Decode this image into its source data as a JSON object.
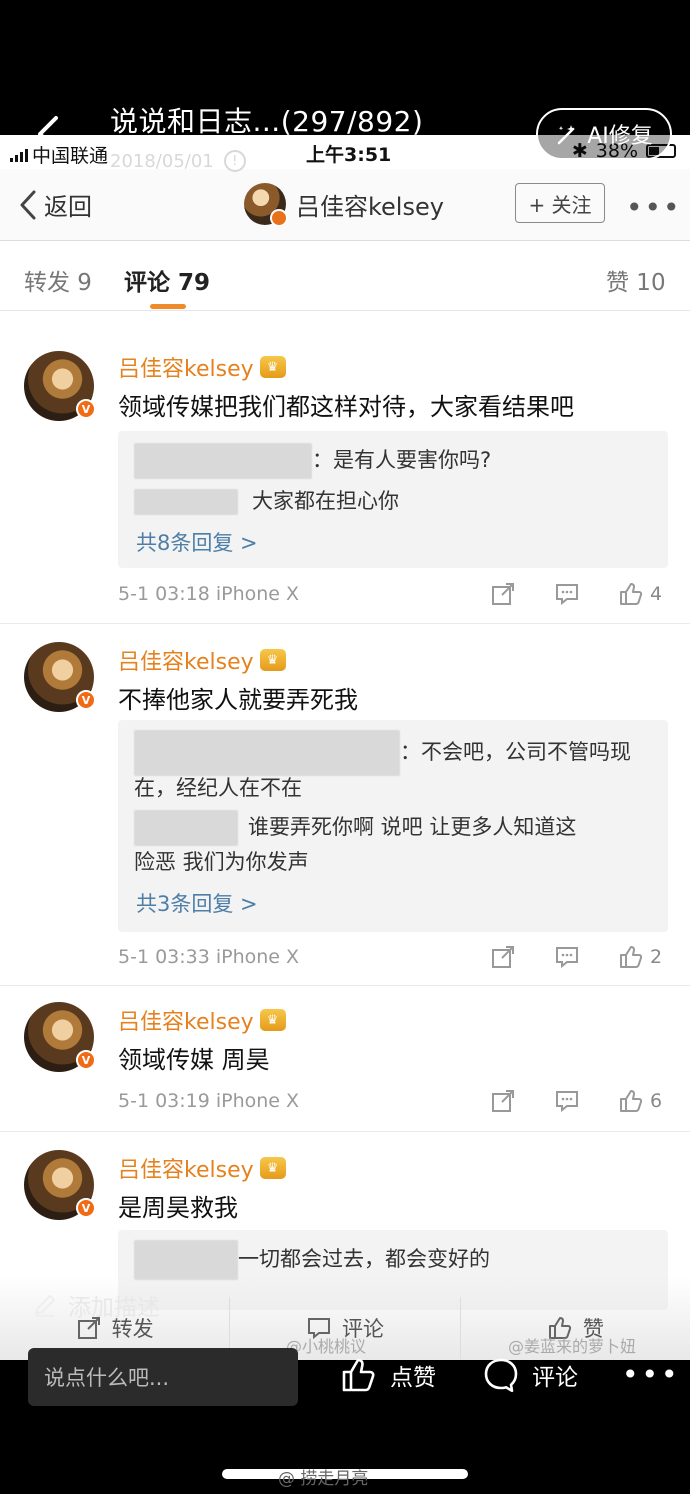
{
  "viewer": {
    "title": "说说和日志...(297/892)",
    "date": "2018/05/01",
    "ai_fix_label": "AI修复",
    "add_description": "添加描述",
    "input_placeholder": "说点什么吧...",
    "like_label": "点赞",
    "comment_label": "评论",
    "bottom_watermark": "@ 捞走月亮"
  },
  "phone_status": {
    "carrier": "中国联通",
    "time": "上午3:51",
    "battery": "38%"
  },
  "weibo_nav": {
    "back_label": "返回",
    "user_name": "吕佳容kelsey",
    "follow_label": "+ 关注",
    "more": "•••"
  },
  "tabs": {
    "repost": "转发 9",
    "comments": "评论 79",
    "likes": "赞 10"
  },
  "comments": [
    {
      "name": "吕佳容kelsey",
      "text": "领域传媒把我们都这样对待，大家看结果吧",
      "replies": [
        "：是有人要害你吗?",
        "大家都在担心你"
      ],
      "more_replies": "共8条回复 >",
      "meta": "5-1 03:18  iPhone X",
      "likes": "4"
    },
    {
      "name": "吕佳容kelsey",
      "text": "不捧他家人就要弄死我",
      "replies": [
        "：不会吧，公司不管吗现",
        "在，经纪人在不在",
        "谁要弄死你啊   说吧   让更多人知道这",
        "险恶  我们为你发声"
      ],
      "more_replies": "共3条回复 >",
      "meta": "5-1 03:33  iPhone X",
      "likes": "2"
    },
    {
      "name": "吕佳容kelsey",
      "text": "领域传媒 周昊",
      "meta": "5-1 03:19  iPhone X",
      "likes": "6"
    },
    {
      "name": "吕佳容kelsey",
      "text": "是周昊救我",
      "replies": [
        "一切都会过去，都会变好的"
      ]
    }
  ],
  "inner_toolbar": {
    "repost": "转发",
    "comment": "评论",
    "like": "赞"
  },
  "watermarks": [
    "@小桃桃议",
    "@姜蓝来的萝卜妞"
  ],
  "colors": {
    "name_orange": "#e5821f",
    "link_blue": "#4d7ea8",
    "tab_underline": "#f08b2c"
  }
}
